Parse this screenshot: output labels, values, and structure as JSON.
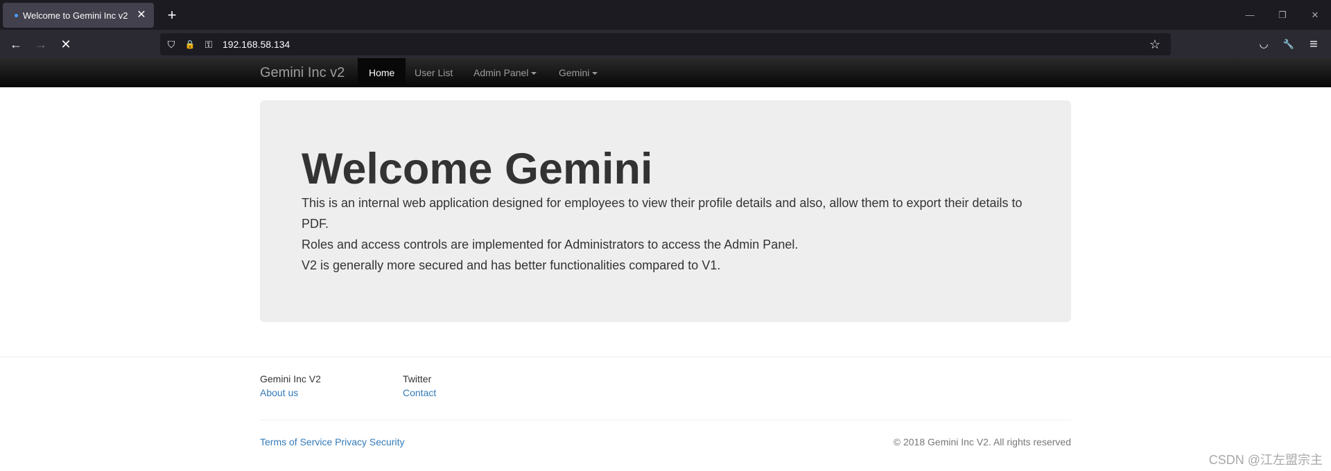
{
  "browser": {
    "tab_title": "Welcome to Gemini Inc v2",
    "tab_close": "✕",
    "new_tab": "+",
    "url": "192.168.58.134",
    "icons": {
      "back": "←",
      "forward": "→",
      "stop": "✕",
      "shield": "⛉",
      "lock": "🔒",
      "key": "⚿",
      "star": "☆",
      "pocket": "◡",
      "wrench": "🔧",
      "menu": "≡",
      "minimize": "—",
      "restore": "❐",
      "close": "✕"
    }
  },
  "site_nav": {
    "brand": "Gemini Inc v2",
    "items": [
      {
        "label": "Home",
        "active": true
      },
      {
        "label": "User List"
      },
      {
        "label": "Admin Panel",
        "dropdown": true
      },
      {
        "label": "Gemini",
        "dropdown": true
      }
    ]
  },
  "jumbotron": {
    "title": "Welcome Gemini",
    "line1": "This is an internal web application designed for employees to view their profile details and also, allow them to export their details to PDF.",
    "line2": "Roles and access controls are implemented for Administrators to access the Admin Panel.",
    "line3": "V2 is generally more secured and has better functionalities compared to V1."
  },
  "footer": {
    "col1": {
      "heading": "Gemini Inc V2",
      "link": "About us"
    },
    "col2": {
      "heading": "Twitter",
      "link": "Contact"
    },
    "bottom_links": "Terms of Service Privacy Security",
    "copyright": "© 2018 Gemini Inc V2. All rights reserved"
  },
  "watermark": "CSDN @江左盟宗主"
}
